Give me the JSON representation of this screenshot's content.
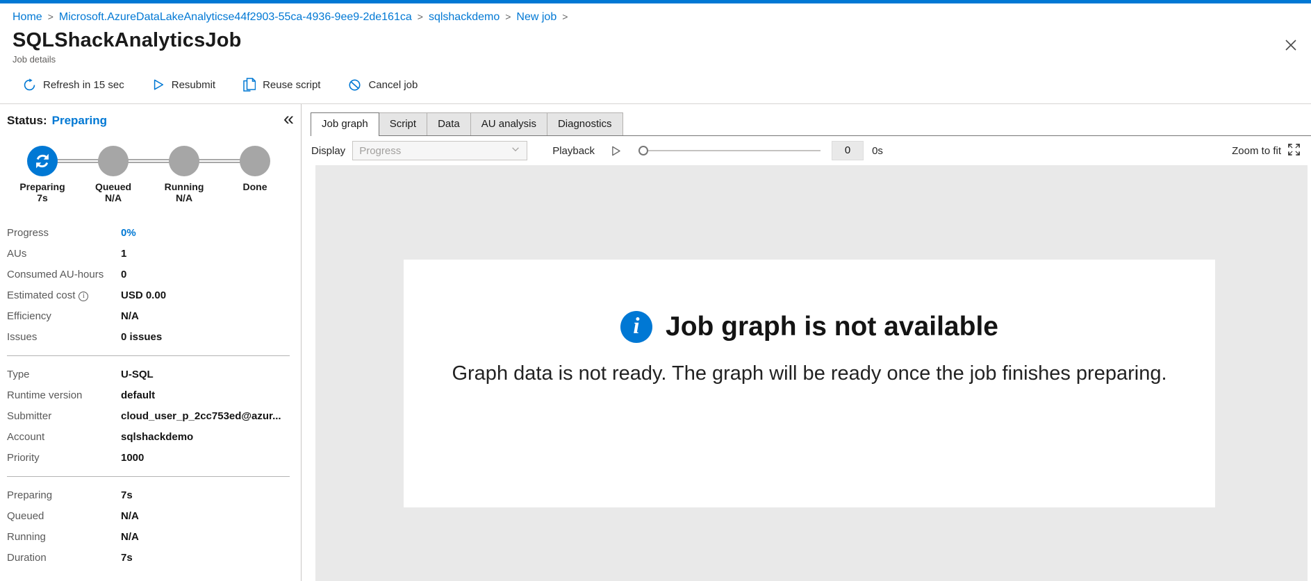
{
  "colors": {
    "accent": "#0078d4",
    "pending_step": "#a6a6a6",
    "graph_background": "#e9e9e9"
  },
  "breadcrumb": {
    "separator": ">",
    "items": [
      "Home",
      "Microsoft.AzureDataLakeAnalyticse44f2903-55ca-4936-9ee9-2de161ca",
      "sqlshackdemo",
      "New job"
    ]
  },
  "header": {
    "title": "SQLShackAnalyticsJob",
    "subtitle": "Job details"
  },
  "toolbar": {
    "items": [
      {
        "icon": "refresh-icon",
        "label": "Refresh in 15 sec"
      },
      {
        "icon": "resubmit-icon",
        "label": "Resubmit"
      },
      {
        "icon": "reuse-script-icon",
        "label": "Reuse script"
      },
      {
        "icon": "cancel-job-icon",
        "label": "Cancel job"
      }
    ]
  },
  "status_panel": {
    "status_label": "Status:",
    "status_value": "Preparing",
    "collapse_icon": "«",
    "steps": [
      {
        "name": "Preparing",
        "time": "7s",
        "state": "active"
      },
      {
        "name": "Queued",
        "time": "N/A",
        "state": "pending"
      },
      {
        "name": "Running",
        "time": "N/A",
        "state": "pending"
      },
      {
        "name": "Done",
        "time": "",
        "state": "pending"
      }
    ],
    "sections": [
      {
        "rows": [
          {
            "label": "Progress",
            "value": "0%",
            "value_color": "#0078d4"
          },
          {
            "label": "AUs",
            "value": "1"
          },
          {
            "label": "Consumed AU-hours",
            "value": "0"
          },
          {
            "label": "Estimated cost",
            "value": "USD 0.00",
            "info": true
          },
          {
            "label": "Efficiency",
            "value": "N/A"
          },
          {
            "label": "Issues",
            "value": "0 issues"
          }
        ]
      },
      {
        "rows": [
          {
            "label": "Type",
            "value": "U-SQL"
          },
          {
            "label": "Runtime version",
            "value": "default"
          },
          {
            "label": "Submitter",
            "value": "cloud_user_p_2cc753ed@azur..."
          },
          {
            "label": "Account",
            "value": "sqlshackdemo"
          },
          {
            "label": "Priority",
            "value": "1000"
          }
        ]
      },
      {
        "rows": [
          {
            "label": "Preparing",
            "value": "7s"
          },
          {
            "label": "Queued",
            "value": "N/A"
          },
          {
            "label": "Running",
            "value": "N/A"
          },
          {
            "label": "Duration",
            "value": "7s"
          }
        ]
      }
    ]
  },
  "tabs": [
    {
      "label": "Job graph",
      "active": true
    },
    {
      "label": "Script",
      "active": false
    },
    {
      "label": "Data",
      "active": false
    },
    {
      "label": "AU analysis",
      "active": false
    },
    {
      "label": "Diagnostics",
      "active": false
    }
  ],
  "controls": {
    "display_label": "Display",
    "display_value": "Progress",
    "playback_label": "Playback",
    "playback_time_value": "0",
    "playback_time_unit": "0s",
    "zoom_to_fit_label": "Zoom to fit"
  },
  "graph_message": {
    "icon_glyph": "i",
    "title": "Job graph is not available",
    "body": "Graph data is not ready. The graph will be ready once the job finishes preparing."
  }
}
